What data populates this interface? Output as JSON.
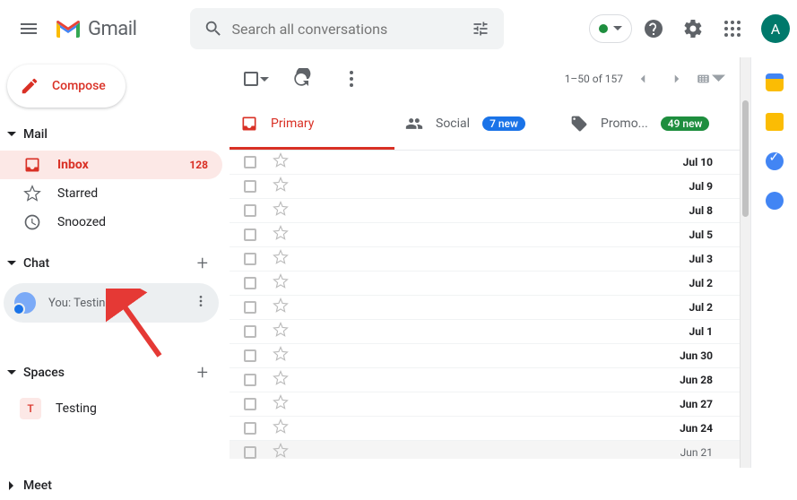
{
  "header": {
    "app_name": "Gmail",
    "search_placeholder": "Search all conversations",
    "avatar_letter": "A"
  },
  "compose_label": "Compose",
  "sections": {
    "mail_label": "Mail",
    "chat_label": "Chat",
    "spaces_label": "Spaces",
    "meet_label": "Meet"
  },
  "nav": {
    "inbox": {
      "label": "Inbox",
      "count": "128"
    },
    "starred": {
      "label": "Starred"
    },
    "snoozed": {
      "label": "Snoozed"
    }
  },
  "chat_item": {
    "preview": "You: Testing"
  },
  "space_item": {
    "initial": "T",
    "label": "Testing"
  },
  "toolbar": {
    "range": "1–50 of 157"
  },
  "tabs": {
    "primary": "Primary",
    "social": "Social",
    "social_badge": "7 new",
    "promo": "Promo...",
    "promo_badge": "49 new"
  },
  "rows": [
    {
      "date": "Jul 10",
      "unread": true
    },
    {
      "date": "Jul 9",
      "unread": true
    },
    {
      "date": "Jul 8",
      "unread": true
    },
    {
      "date": "Jul 5",
      "unread": true
    },
    {
      "date": "Jul 3",
      "unread": true
    },
    {
      "date": "Jul 2",
      "unread": true
    },
    {
      "date": "Jul 2",
      "unread": true
    },
    {
      "date": "Jul 1",
      "unread": true
    },
    {
      "date": "Jun 30",
      "unread": true
    },
    {
      "date": "Jun 28",
      "unread": true
    },
    {
      "date": "Jun 27",
      "unread": true
    },
    {
      "date": "Jun 24",
      "unread": true
    },
    {
      "date": "Jun 21",
      "unread": false
    }
  ],
  "icons": {
    "menu": "menu-icon",
    "search": "search-icon",
    "tune": "tune-icon",
    "help": "help-icon",
    "settings": "gear-icon",
    "apps": "apps-grid-icon",
    "compose": "pencil-icon",
    "refresh": "refresh-icon",
    "more": "more-vert-icon",
    "prev": "chevron-left-icon",
    "next": "chevron-right-icon",
    "keyboard": "keyboard-icon",
    "inbox": "inbox-icon",
    "star": "star-icon",
    "clock": "clock-icon",
    "social": "people-icon",
    "promo": "tag-icon"
  },
  "side_panel": [
    "calendar",
    "keep",
    "tasks",
    "contacts"
  ]
}
